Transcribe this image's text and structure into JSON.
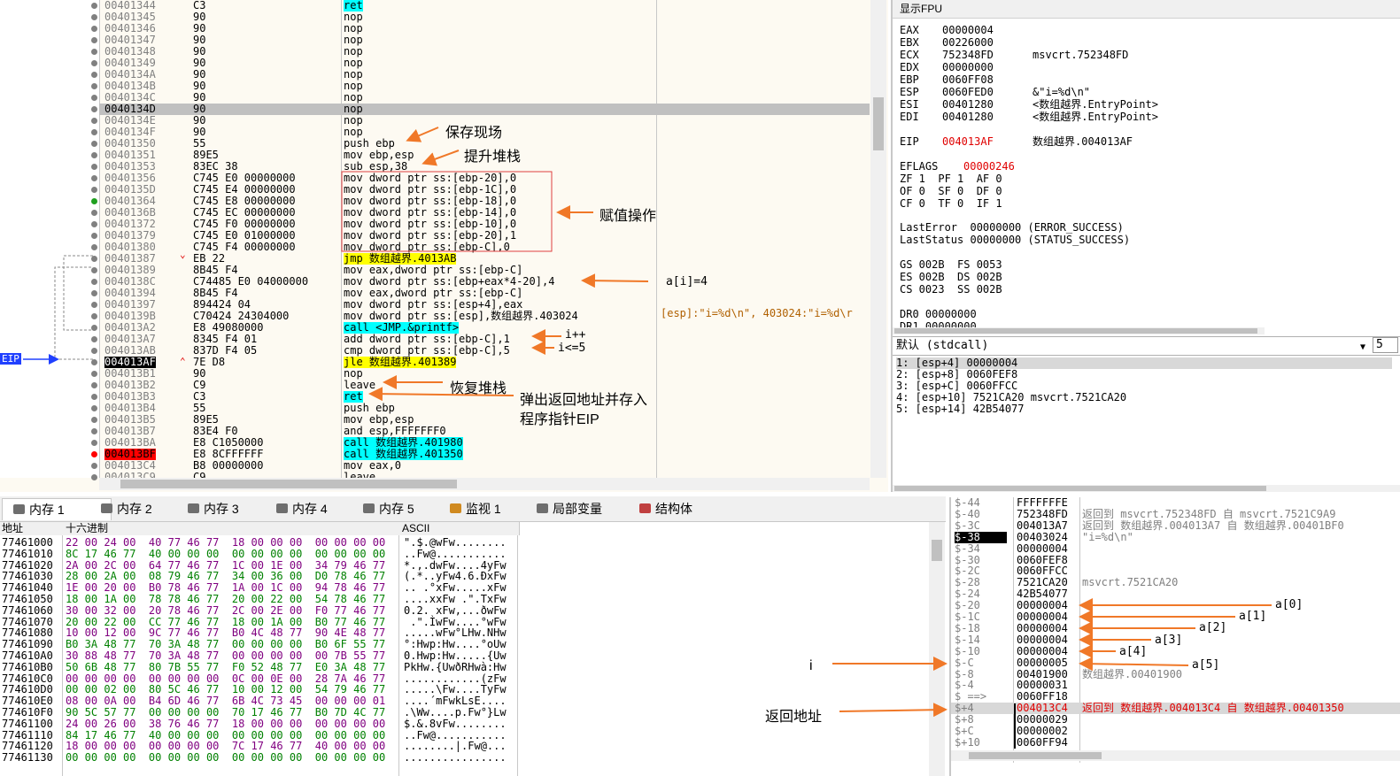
{
  "disasm": {
    "rows": [
      {
        "addr": "00401344",
        "bytes": "C3",
        "instr": "ret",
        "kind": "ret"
      },
      {
        "addr": "00401345",
        "bytes": "90",
        "instr": "nop",
        "kind": "nop"
      },
      {
        "addr": "00401346",
        "bytes": "90",
        "instr": "nop",
        "kind": "nop"
      },
      {
        "addr": "00401347",
        "bytes": "90",
        "instr": "nop",
        "kind": "nop"
      },
      {
        "addr": "00401348",
        "bytes": "90",
        "instr": "nop",
        "kind": "nop"
      },
      {
        "addr": "00401349",
        "bytes": "90",
        "instr": "nop",
        "kind": "nop"
      },
      {
        "addr": "0040134A",
        "bytes": "90",
        "instr": "nop",
        "kind": "nop"
      },
      {
        "addr": "0040134B",
        "bytes": "90",
        "instr": "nop",
        "kind": "nop"
      },
      {
        "addr": "0040134C",
        "bytes": "90",
        "instr": "nop",
        "kind": "nop"
      },
      {
        "addr": "0040134D",
        "bytes": "90",
        "instr": "nop",
        "kind": "sel"
      },
      {
        "addr": "0040134E",
        "bytes": "90",
        "instr": "nop",
        "kind": "nop"
      },
      {
        "addr": "0040134F",
        "bytes": "90",
        "instr": "nop",
        "kind": "nop"
      },
      {
        "addr": "00401350",
        "bytes": "55",
        "instr": "push ebp",
        "kind": "plain"
      },
      {
        "addr": "00401351",
        "bytes": "89E5",
        "instr": "mov ebp,esp",
        "kind": "plain"
      },
      {
        "addr": "00401353",
        "bytes": "83EC 38",
        "instr": "sub esp,38",
        "kind": "plain"
      },
      {
        "addr": "00401356",
        "bytes": "C745 E0 00000000",
        "instr": "mov dword ptr ss:[ebp-20],0",
        "kind": "plain"
      },
      {
        "addr": "0040135D",
        "bytes": "C745 E4 00000000",
        "instr": "mov dword ptr ss:[ebp-1C],0",
        "kind": "plain"
      },
      {
        "addr": "00401364",
        "bytes": "C745 E8 00000000",
        "instr": "mov dword ptr ss:[ebp-18],0",
        "kind": "plain"
      },
      {
        "addr": "0040136B",
        "bytes": "C745 EC 00000000",
        "instr": "mov dword ptr ss:[ebp-14],0",
        "kind": "plain"
      },
      {
        "addr": "00401372",
        "bytes": "C745 F0 00000000",
        "instr": "mov dword ptr ss:[ebp-10],0",
        "kind": "plain"
      },
      {
        "addr": "00401379",
        "bytes": "C745 E0 01000000",
        "instr": "mov dword ptr ss:[ebp-20],1",
        "kind": "plain"
      },
      {
        "addr": "00401380",
        "bytes": "C745 F4 00000000",
        "instr": "mov dword ptr ss:[ebp-C],0",
        "kind": "plain"
      },
      {
        "addr": "00401387",
        "bytes": "EB 22",
        "instr": "jmp 数组越界.4013AB",
        "kind": "jmp"
      },
      {
        "addr": "00401389",
        "bytes": "8B45 F4",
        "instr": "mov eax,dword ptr ss:[ebp-C]",
        "kind": "plain"
      },
      {
        "addr": "0040138C",
        "bytes": "C74485 E0 04000000",
        "instr": "mov dword ptr ss:[ebp+eax*4-20],4",
        "kind": "plain"
      },
      {
        "addr": "00401394",
        "bytes": "8B45 F4",
        "instr": "mov eax,dword ptr ss:[ebp-C]",
        "kind": "plain"
      },
      {
        "addr": "00401397",
        "bytes": "894424 04",
        "instr": "mov dword ptr ss:[esp+4],eax",
        "kind": "plain"
      },
      {
        "addr": "0040139B",
        "bytes": "C70424 24304000",
        "instr": "mov dword ptr ss:[esp],数组越界.403024",
        "kind": "plain"
      },
      {
        "addr": "004013A2",
        "bytes": "E8 49080000",
        "instr": "call <JMP.&printf>",
        "kind": "call"
      },
      {
        "addr": "004013A7",
        "bytes": "8345 F4 01",
        "instr": "add dword ptr ss:[ebp-C],1",
        "kind": "plain"
      },
      {
        "addr": "004013AB",
        "bytes": "837D F4 05",
        "instr": "cmp dword ptr ss:[ebp-C],5",
        "kind": "plain"
      },
      {
        "addr": "004013AF",
        "bytes": "7E D8",
        "instr": "jle 数组越界.401389",
        "kind": "eip"
      },
      {
        "addr": "004013B1",
        "bytes": "90",
        "instr": "nop",
        "kind": "nop"
      },
      {
        "addr": "004013B2",
        "bytes": "C9",
        "instr": "leave",
        "kind": "plain"
      },
      {
        "addr": "004013B3",
        "bytes": "C3",
        "instr": "ret",
        "kind": "ret"
      },
      {
        "addr": "004013B4",
        "bytes": "55",
        "instr": "push ebp",
        "kind": "plain"
      },
      {
        "addr": "004013B5",
        "bytes": "89E5",
        "instr": "mov ebp,esp",
        "kind": "plain"
      },
      {
        "addr": "004013B7",
        "bytes": "83E4 F0",
        "instr": "and esp,FFFFFFF0",
        "kind": "plain"
      },
      {
        "addr": "004013BA",
        "bytes": "E8 C1050000",
        "instr": "call 数组越界.401980",
        "kind": "call"
      },
      {
        "addr": "004013BF",
        "bytes": "E8 8CFFFFFF",
        "instr": "call 数组越界.401350",
        "kind": "bp"
      },
      {
        "addr": "004013C4",
        "bytes": "B8 00000000",
        "instr": "mov eax,0",
        "kind": "plain"
      },
      {
        "addr": "004013C9",
        "bytes": "C9",
        "instr": "leave",
        "kind": "plain"
      }
    ],
    "eip_label": "EIP",
    "arrow_glyph": "⌄",
    "arrow_up_glyph": "⌃",
    "side_comment": "[esp]:\"i=%d\\n\", 403024:\"i=%d\\r"
  },
  "annotations": {
    "save_context": "保存现场",
    "raise_stack": "提升堆栈",
    "assign_op": "赋值操作",
    "a_i_eq_4": "a[i]=4",
    "i_inc": "i++",
    "i_le_5": "i<=5",
    "restore_stack": "恢复堆栈",
    "pop_ret_1": "弹出返回地址并存入",
    "pop_ret_2": "程序指针EIP",
    "i_label": "i",
    "ret_addr_label": "返回地址",
    "a0": "a[0]",
    "a1": "a[1]",
    "a2": "a[2]",
    "a3": "a[3]",
    "a4": "a[4]",
    "a5": "a[5]"
  },
  "registers": {
    "title": "显示FPU",
    "lines": [
      {
        "name": "EAX",
        "val": "00000004",
        "comment": ""
      },
      {
        "name": "EBX",
        "val": "00226000",
        "comment": ""
      },
      {
        "name": "ECX",
        "val": "752348FD",
        "comment": "msvcrt.752348FD"
      },
      {
        "name": "EDX",
        "val": "00000000",
        "comment": ""
      },
      {
        "name": "EBP",
        "val": "0060FF08",
        "comment": ""
      },
      {
        "name": "ESP",
        "val": "0060FED0",
        "comment": "&\"i=%d\\n\""
      },
      {
        "name": "ESI",
        "val": "00401280",
        "comment": "<数组越界.EntryPoint>"
      },
      {
        "name": "EDI",
        "val": "00401280",
        "comment": "<数组越界.EntryPoint>"
      }
    ],
    "eip": {
      "name": "EIP",
      "val": "004013AF",
      "comment": "数组越界.004013AF"
    },
    "eflags": {
      "name": "EFLAGS",
      "val": "00000246"
    },
    "flags_lines": [
      "ZF 1  PF 1  AF 0",
      "OF 0  SF 0  DF 0",
      "CF 0  TF 0  IF 1"
    ],
    "last_error": "LastError  00000000 (ERROR_SUCCESS)",
    "last_status": "LastStatus 00000000 (STATUS_SUCCESS)",
    "seg_lines": [
      "GS 002B  FS 0053",
      "ES 002B  DS 002B",
      "CS 0023  SS 002B"
    ],
    "dr_lines": [
      "DR0 00000000",
      "DR1 00000000"
    ]
  },
  "call_args": {
    "convention": "默认 (stdcall)",
    "count": "5",
    "lines": [
      "1: [esp+4] 00000004",
      "2: [esp+8] 0060FEF8",
      "3: [esp+C] 0060FFCC",
      "4: [esp+10] 7521CA20 msvcrt.7521CA20",
      "5: [esp+14] 42B54077"
    ]
  },
  "tabs": [
    {
      "label": "内存 1",
      "active": true
    },
    {
      "label": "内存 2",
      "active": false
    },
    {
      "label": "内存 3",
      "active": false
    },
    {
      "label": "内存 4",
      "active": false
    },
    {
      "label": "内存 5",
      "active": false
    },
    {
      "label": "监视 1",
      "active": false
    },
    {
      "label": "局部变量",
      "active": false
    },
    {
      "label": "结构体",
      "active": false
    }
  ],
  "dump": {
    "headers": {
      "addr": "地址",
      "hex": "十六进制",
      "ascii": "ASCII"
    },
    "rows": [
      {
        "a": "77461000",
        "h": "22 00 24 00  40 77 46 77  18 00 00 00  00 00 00 00",
        "s": "\".$.@wFw........"
      },
      {
        "a": "77461010",
        "h": "8C 17 46 77  40 00 00 00  00 00 00 00  00 00 00 00",
        "s": "..Fw@..........."
      },
      {
        "a": "77461020",
        "h": "2A 00 2C 00  64 77 46 77  1C 00 1E 00  34 79 46 77",
        "s": "*.,.dwFw....4yFw"
      },
      {
        "a": "77461030",
        "h": "28 00 2A 00  08 79 46 77  34 00 36 00  D0 78 46 77",
        "s": "(.*..yFw4.6.ÐxFw"
      },
      {
        "a": "77461040",
        "h": "1E 00 20 00  B0 78 46 77  1A 00 1C 00  94 78 46 77",
        "s": ".. .°xFw.....xFw"
      },
      {
        "a": "77461050",
        "h": "18 00 1A 00  78 78 46 77  20 00 22 00  54 78 46 77",
        "s": "....xxFw .\".TxFw"
      },
      {
        "a": "77461060",
        "h": "30 00 32 00  20 78 46 77  2C 00 2E 00  F0 77 46 77",
        "s": "0.2. xFw,...ðwFw"
      },
      {
        "a": "77461070",
        "h": "20 00 22 00  CC 77 46 77  18 00 1A 00  B0 77 46 77",
        "s": " .\".ÌwFw....°wFw"
      },
      {
        "a": "77461080",
        "h": "10 00 12 00  9C 77 46 77  B0 4C 48 77  90 4E 48 77",
        "s": ".....wFw°LHw.NHw"
      },
      {
        "a": "77461090",
        "h": "B0 3A 48 77  70 3A 48 77  00 00 00 00  B0 6F 55 77",
        "s": "°:Hwp:Hw....°oUw"
      },
      {
        "a": "774610A0",
        "h": "30 88 48 77  70 3A 48 77  00 00 00 00  00 7B 55 77",
        "s": "0.Hwp:Hw.....{Uw"
      },
      {
        "a": "774610B0",
        "h": "50 6B 48 77  80 7B 55 77  F0 52 48 77  E0 3A 48 77",
        "s": "PkHw.{UwðRHwà:Hw"
      },
      {
        "a": "774610C0",
        "h": "00 00 00 00  00 00 00 00  0C 00 0E 00  28 7A 46 77",
        "s": "............(zFw"
      },
      {
        "a": "774610D0",
        "h": "00 00 02 00  80 5C 46 77  10 00 12 00  54 79 46 77",
        "s": ".....\\Fw....TyFw"
      },
      {
        "a": "774610E0",
        "h": "08 00 0A 00  B4 6D 46 77  6B 4C 73 45  00 00 00 01",
        "s": "....´mFwkLsE...."
      },
      {
        "a": "774610F0",
        "h": "90 5C 57 77  00 00 00 00  70 17 46 77  B0 7D 4C 77",
        "s": ".\\Ww....p.Fw°}Lw"
      },
      {
        "a": "77461100",
        "h": "24 00 26 00  38 76 46 77  18 00 00 00  00 00 00 00",
        "s": "$.&.8vFw........"
      },
      {
        "a": "77461110",
        "h": "84 17 46 77  40 00 00 00  00 00 00 00  00 00 00 00",
        "s": "..Fw@..........."
      },
      {
        "a": "77461120",
        "h": "18 00 00 00  00 00 00 00  7C 17 46 77  40 00 00 00",
        "s": "........|.Fw@..."
      },
      {
        "a": "77461130",
        "h": "00 00 00 00  00 00 00 00  00 00 00 00  00 00 00 00",
        "s": "................"
      }
    ]
  },
  "stack": {
    "rows": [
      {
        "o": "$-44",
        "v": "FFFFFFFE",
        "c": "",
        "kind": ""
      },
      {
        "o": "$-40",
        "v": "752348FD",
        "c": "返回到 msvcrt.752348FD 自 msvcrt.7521C9A9",
        "kind": ""
      },
      {
        "o": "$-3C",
        "v": "004013A7",
        "c": "返回到 数组越界.004013A7 自 数组越界.00401BF0",
        "kind": ""
      },
      {
        "o": "$-38",
        "v": "00403024",
        "c": "\"i=%d\\n\"",
        "kind": "cur"
      },
      {
        "o": "$-34",
        "v": "00000004",
        "c": "",
        "kind": ""
      },
      {
        "o": "$-30",
        "v": "0060FEF8",
        "c": "",
        "kind": ""
      },
      {
        "o": "$-2C",
        "v": "0060FFCC",
        "c": "",
        "kind": ""
      },
      {
        "o": "$-28",
        "v": "7521CA20",
        "c": "msvcrt.7521CA20",
        "kind": ""
      },
      {
        "o": "$-24",
        "v": "42B54077",
        "c": "",
        "kind": ""
      },
      {
        "o": "$-20",
        "v": "00000004",
        "c": "",
        "kind": ""
      },
      {
        "o": "$-1C",
        "v": "00000004",
        "c": "",
        "kind": ""
      },
      {
        "o": "$-18",
        "v": "00000004",
        "c": "",
        "kind": ""
      },
      {
        "o": "$-14",
        "v": "00000004",
        "c": "",
        "kind": ""
      },
      {
        "o": "$-10",
        "v": "00000004",
        "c": "",
        "kind": ""
      },
      {
        "o": "$-C",
        "v": "00000005",
        "c": "",
        "kind": ""
      },
      {
        "o": "$-8",
        "v": "00401900",
        "c": "数组越界.00401900",
        "kind": ""
      },
      {
        "o": "$-4",
        "v": "00000031",
        "c": "",
        "kind": ""
      },
      {
        "o": "$ ==>",
        "v": "0060FF18",
        "c": "",
        "kind": ""
      },
      {
        "o": "$+4",
        "v": "004013C4",
        "c": "返回到 数组越界.004013C4 自 数组越界.00401350",
        "kind": "hl"
      },
      {
        "o": "$+8",
        "v": "00000029",
        "c": "",
        "kind": ""
      },
      {
        "o": "$+C",
        "v": "00000002",
        "c": "",
        "kind": ""
      },
      {
        "o": "$+10",
        "v": "0060FF94",
        "c": "",
        "kind": ""
      }
    ]
  },
  "colors": {
    "annotation_arrow": "#f07828",
    "eip_marker": "#2040ff",
    "breakpoint": "#ff0000",
    "underline_red": "#e00000",
    "underline_blue": "#0000c0"
  }
}
